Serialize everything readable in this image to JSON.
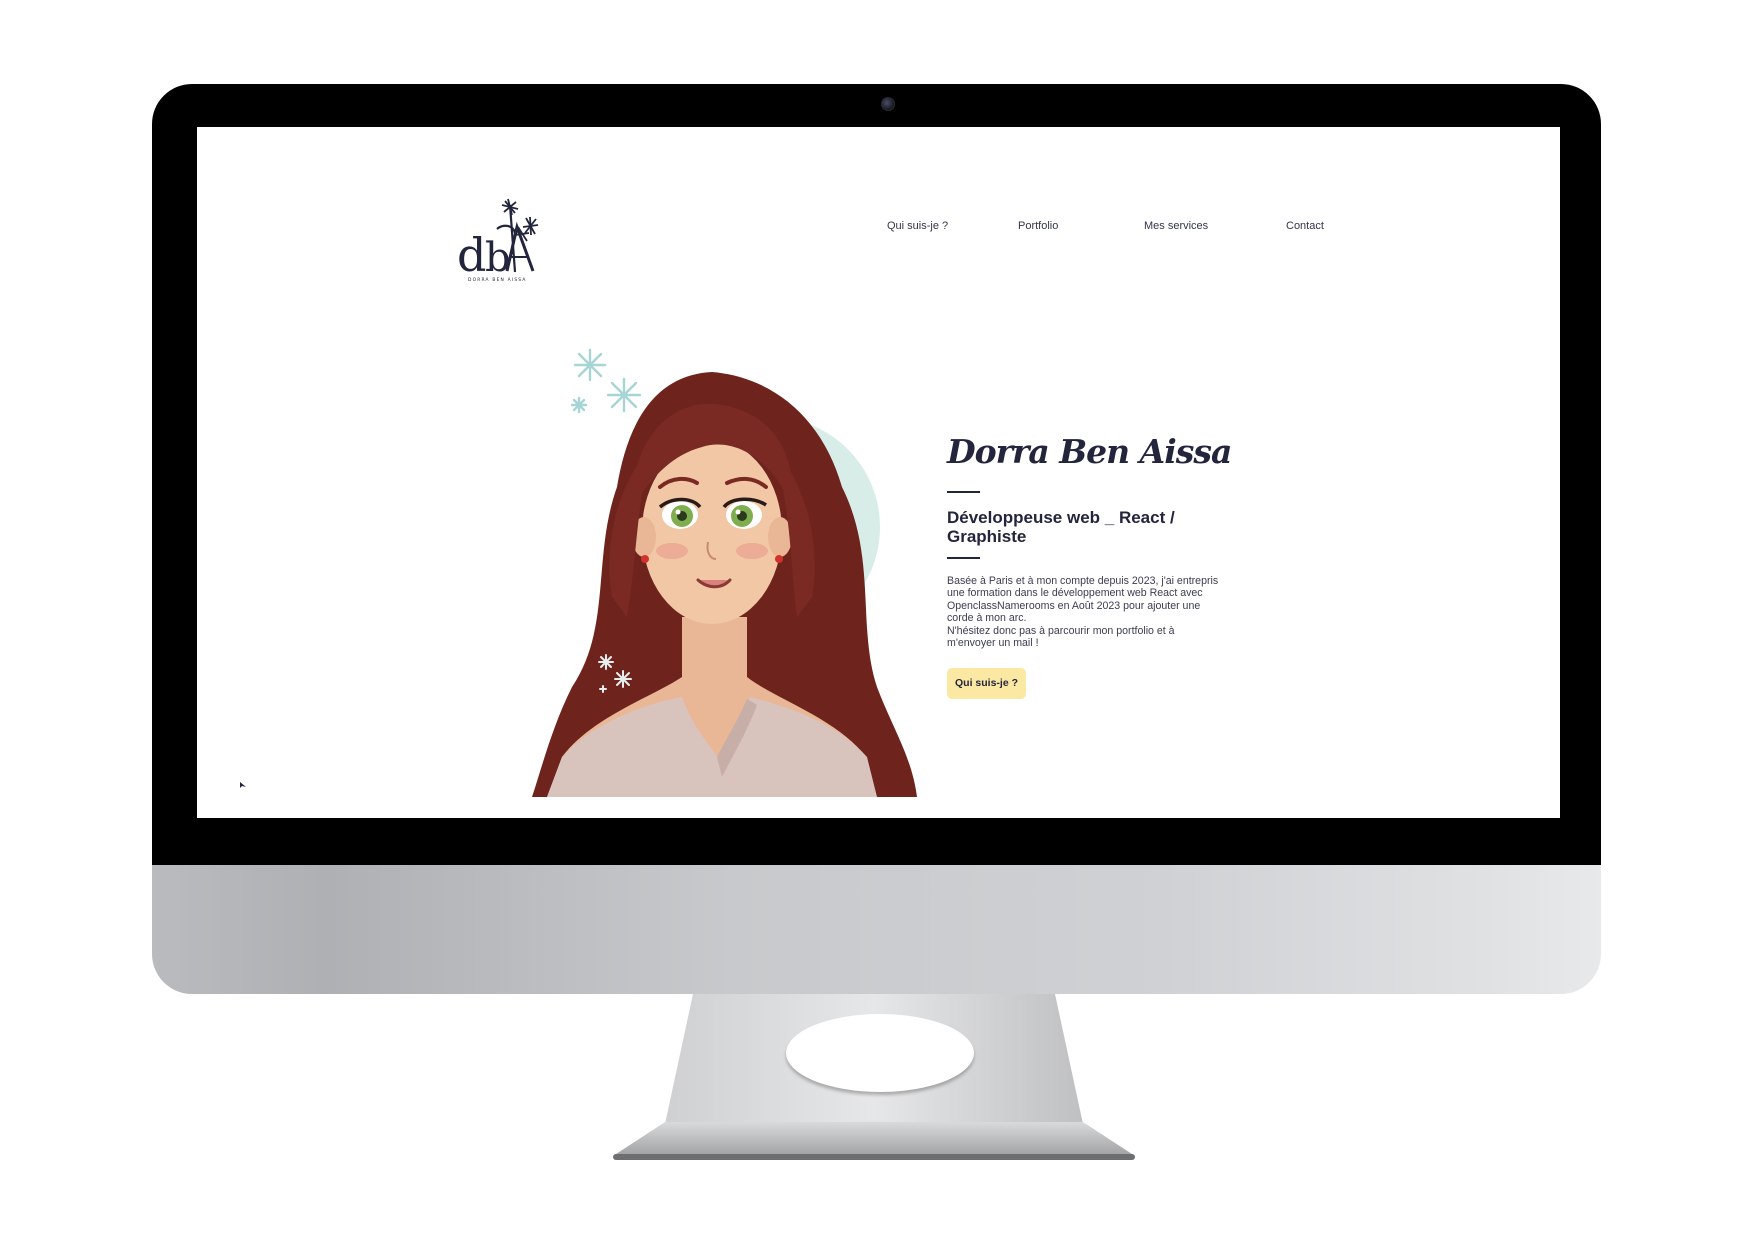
{
  "site": {
    "logo": {
      "monogram": "dbA",
      "caption": "DORRA BEN AISSA",
      "icon": "flower-logo-icon"
    },
    "nav": [
      {
        "label": "Qui suis-je ?"
      },
      {
        "label": "Portfolio"
      },
      {
        "label": "Mes services"
      },
      {
        "label": "Contact"
      }
    ],
    "hero": {
      "name": "Dorra Ben Aissa",
      "role": "Développeuse web _ React / Graphiste",
      "description": [
        "Basée à Paris et à mon compte depuis 2023, j'ai entrepris",
        "une formation dans le développement web React avec",
        "OpenclassNamerooms en Août 2023 pour ajouter une",
        "corde à mon arc.",
        "N'hésitez donc pas à parcourir mon portfolio et à",
        "m'envoyer un mail !"
      ],
      "cta_label": "Qui suis-je ?",
      "portrait_icon": "avatar-illustration"
    }
  },
  "colors": {
    "navy": "#23253d",
    "cta_bg": "#fbe8a3",
    "mint": "#d8ede8",
    "hair": "#7a2a22"
  }
}
